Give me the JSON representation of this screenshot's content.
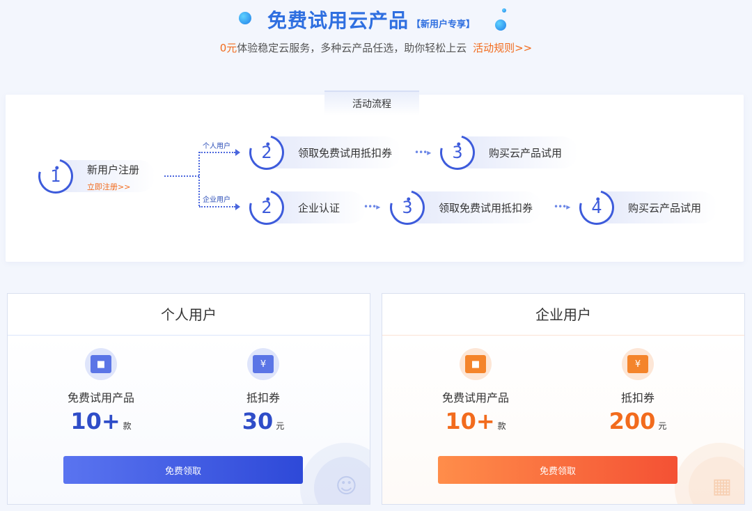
{
  "header": {
    "title": "免费试用云产品",
    "tag": "【新用户专享】",
    "subtitle_zero": "0元",
    "subtitle_text": "体验稳定云服务，多种云产品任选，助你轻松上云",
    "rules_link": "活动规则>>"
  },
  "process": {
    "tab_label": "活动流程",
    "register": {
      "num": "1",
      "label": "新用户注册",
      "link": "立即注册>>"
    },
    "personal_branch_label": "个人用户",
    "enterprise_branch_label": "企业用户",
    "personal_steps": [
      {
        "num": "2",
        "label": "领取免费试用抵扣券"
      },
      {
        "num": "3",
        "label": "购买云产品试用"
      }
    ],
    "enterprise_steps": [
      {
        "num": "2",
        "label": "企业认证"
      },
      {
        "num": "3",
        "label": "领取免费试用抵扣券"
      },
      {
        "num": "4",
        "label": "购买云产品试用"
      }
    ],
    "mini_arrow": "•••▸"
  },
  "cards": {
    "personal": {
      "title": "个人用户",
      "products_label": "免费试用产品",
      "products_value": "10+",
      "products_unit": "款",
      "coupon_label": "抵扣券",
      "coupon_value": "30",
      "coupon_unit": "元",
      "button": "免费领取"
    },
    "enterprise": {
      "title": "企业用户",
      "products_label": "免费试用产品",
      "products_value": "10+",
      "products_unit": "款",
      "coupon_label": "抵扣券",
      "coupon_value": "200",
      "coupon_unit": "元",
      "button": "免费领取"
    }
  },
  "icons": {
    "product": "box-icon",
    "coupon_glyph": "¥"
  },
  "colors": {
    "brand_blue": "#2f4dc8",
    "accent_orange": "#f26b1d"
  }
}
